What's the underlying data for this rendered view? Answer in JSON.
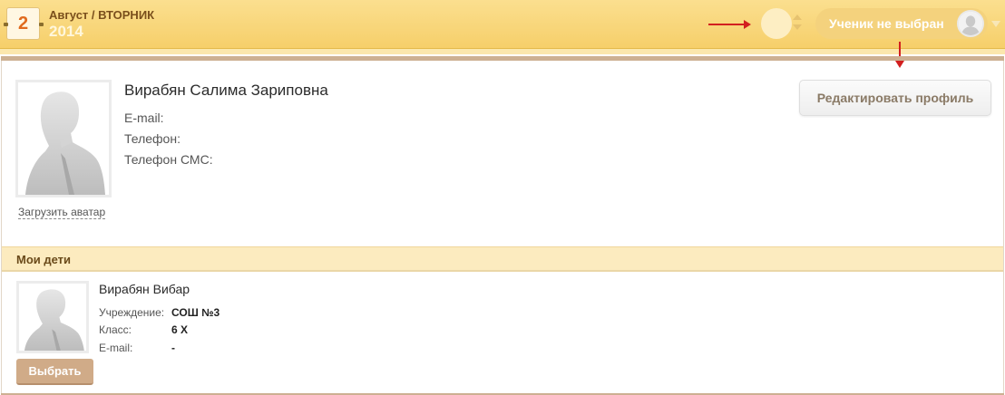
{
  "header": {
    "day": "2",
    "month_weekday": "Август / ВТОРНИК",
    "year": "2014",
    "student_select_label": "Ученик не выбран",
    "icons": {
      "student_avatar": "user-silhouette-icon",
      "dropdown": "caret-down-icon",
      "spinner": "up-down-arrows-icon"
    }
  },
  "profile": {
    "name": "Вирабян Салима Зариповна",
    "email_label": "E-mail:",
    "phone_label": "Телефон:",
    "sms_phone_label": "Телефон СМС:",
    "upload_avatar_label": "Загрузить аватар",
    "edit_profile_label": "Редактировать профиль"
  },
  "children_section": {
    "title": "Мои дети",
    "children": [
      {
        "name": "Вирабян Вибар",
        "institution_label": "Учреждение:",
        "institution_value": "СОШ №3",
        "class_label": "Класс:",
        "class_value": "6 Х",
        "email_label": "E-mail:",
        "email_value": "-",
        "select_label": "Выбрать"
      }
    ]
  },
  "colors": {
    "topbar": "#f6cf6a",
    "accent_orange": "#e06a1d",
    "annotation_red": "#d21f1f",
    "section_header": "#fcebbf",
    "select_button": "#d0ab88"
  }
}
